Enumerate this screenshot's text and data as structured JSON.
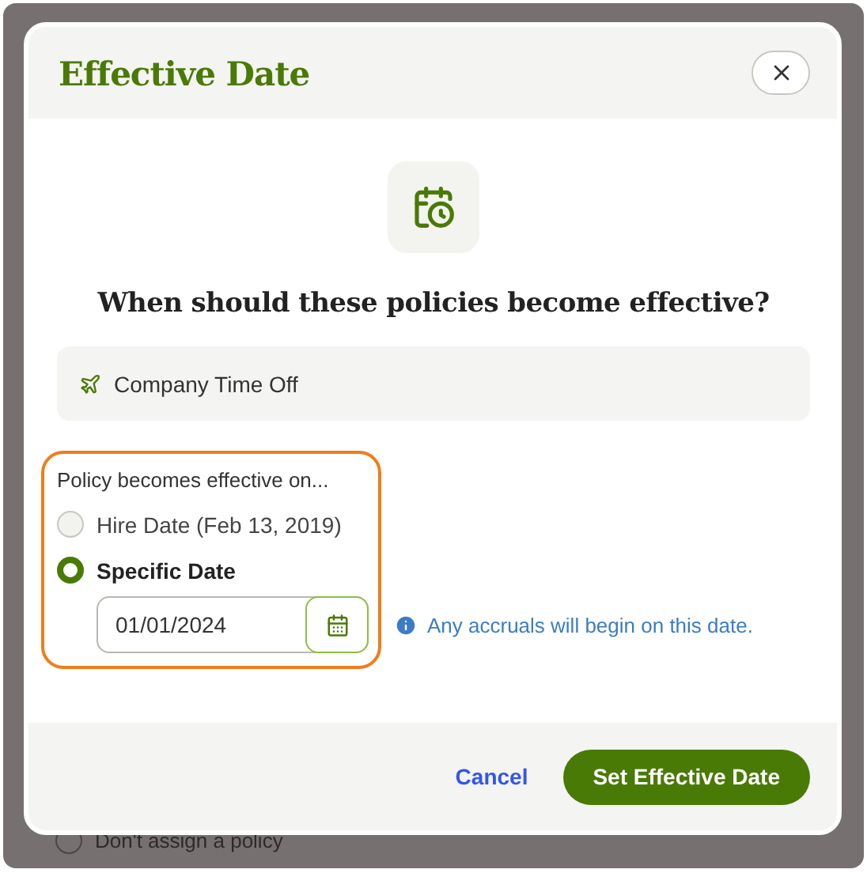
{
  "dialog": {
    "title": "Effective Date",
    "heading": "When should these policies become effective?",
    "policies": [
      {
        "name": "Company Time Off"
      }
    ],
    "options_label": "Policy becomes effective on...",
    "options": [
      {
        "label": "Hire Date (Feb 13, 2019)",
        "selected": false
      },
      {
        "label": "Specific Date",
        "selected": true
      }
    ],
    "date_field": {
      "value": "01/01/2024"
    },
    "note": "Any accruals will begin on this date.",
    "buttons": {
      "cancel": "Cancel",
      "confirm": "Set Effective Date"
    }
  },
  "background": {
    "option": "Don't assign a policy",
    "selected": false
  }
}
